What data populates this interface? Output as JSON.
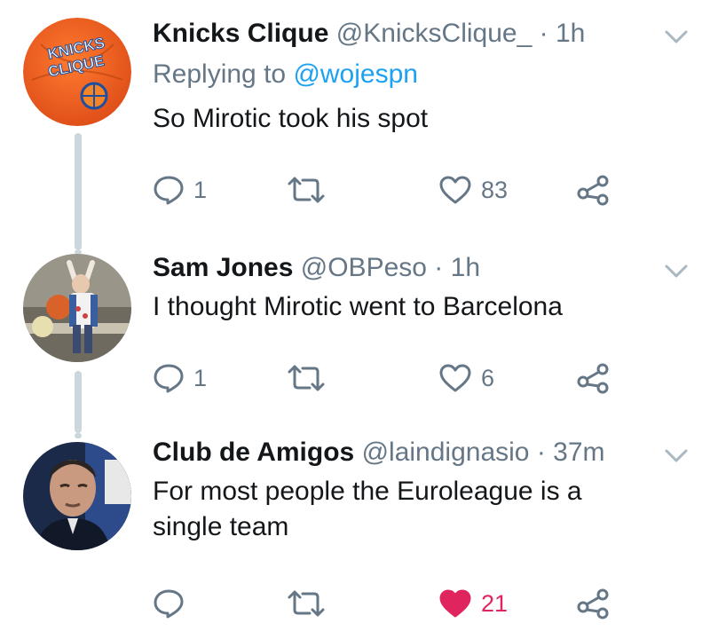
{
  "colors": {
    "like_active": "#e0245e",
    "link": "#1da1f2",
    "muted": "#657786",
    "thread_line": "#ccd6dd"
  },
  "tweets": [
    {
      "name": "Knicks Clique",
      "handle": "@KnicksClique_",
      "dot": "·",
      "time": "1h",
      "replying_label": "Replying to",
      "replying_handle": "@wojespn",
      "text": "So Mirotic took his spot",
      "avatar_logo_text": [
        "KNICKS",
        "CLIQUE"
      ],
      "replies": "1",
      "retweets": "",
      "likes": "83",
      "liked": false
    },
    {
      "name": "Sam Jones",
      "handle": "@OBPeso",
      "dot": "·",
      "time": "1h",
      "text": "I thought Mirotic went to Barcelona",
      "replies": "1",
      "retweets": "",
      "likes": "6",
      "liked": false
    },
    {
      "name": "Club de Amigos",
      "handle": "@laindignasio",
      "dot": "·",
      "time": "37m",
      "text": "For most people the Euroleague is a single team",
      "replies": "",
      "retweets": "",
      "likes": "21",
      "liked": true
    }
  ]
}
